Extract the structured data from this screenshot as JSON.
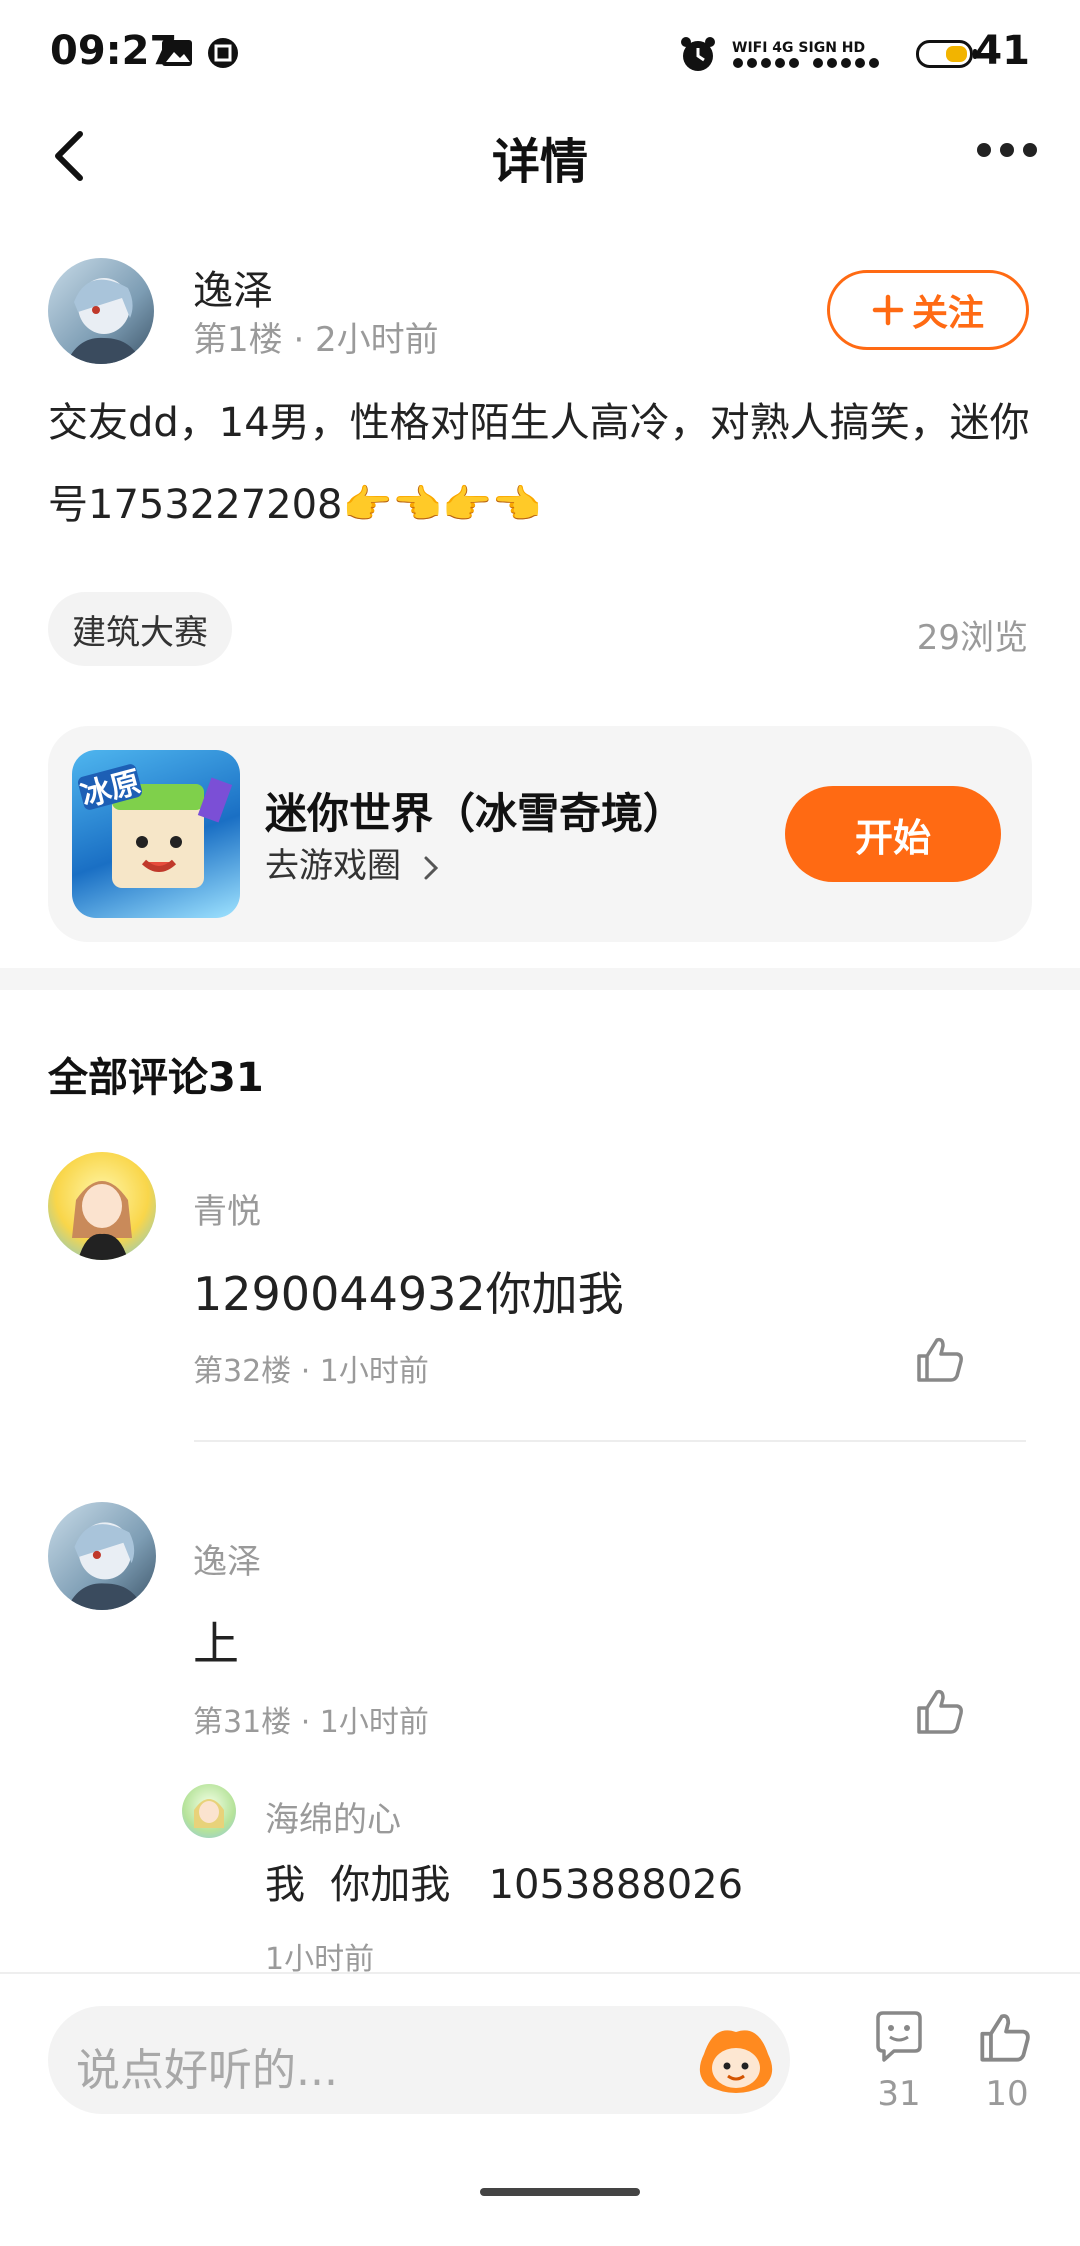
{
  "status_bar": {
    "time": "09:27",
    "network": "WIFI 4G SIGN HD",
    "battery": "41"
  },
  "header": {
    "title": "详情"
  },
  "post": {
    "author": "逸泽",
    "meta": "第1楼 · 2小时前",
    "follow_label": "关注",
    "text": "交友dd，14男，性格对陌生人高冷，对熟人搞笑，迷你号1753227208👉👈👉👈",
    "tag": "建筑大赛",
    "views": "29浏览"
  },
  "game": {
    "title": "迷你世界（冰雪奇境）",
    "subtitle": "去游戏圈",
    "button": "开始",
    "icon_text": "冰原"
  },
  "comments": {
    "header": "全部评论31",
    "items": [
      {
        "name": "青悦",
        "text": "1290044932你加我",
        "meta": "第32楼 · 1小时前"
      },
      {
        "name": "逸泽",
        "text": "上",
        "meta": "第31楼 · 1小时前"
      }
    ],
    "reply": {
      "name": "海绵的心",
      "text": "我  你加我   1053888026",
      "meta": "1小时前"
    }
  },
  "bottom_bar": {
    "placeholder": "说点好听的...",
    "comment_count": "31",
    "like_count": "10"
  },
  "colors": {
    "accent": "#ff6a13"
  }
}
